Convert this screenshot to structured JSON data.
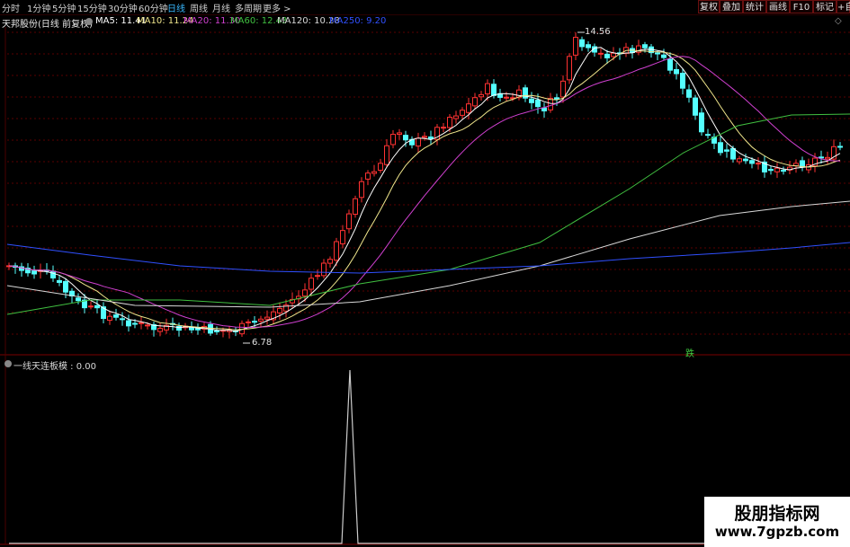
{
  "toolbar": {
    "periods": [
      "分时",
      "1分钟",
      "5分钟",
      "15分钟",
      "30分钟",
      "60分钟",
      "日线",
      "周线",
      "月线",
      "多周期",
      "更多 >"
    ],
    "active_period": "日线",
    "buttons": [
      "复权",
      "叠加",
      "统计",
      "画线",
      "F10",
      "标记",
      "+自"
    ]
  },
  "header": {
    "title": "天邦股份(日线 前复权)",
    "ma": [
      {
        "label": "MA5: 11.41",
        "color": "#ffffff"
      },
      {
        "label": "MA10: 11.24",
        "color": "#f0e68c"
      },
      {
        "label": "MA20: 11.30",
        "color": "#d040d0"
      },
      {
        "label": "MA60: 12.43",
        "color": "#40c040"
      },
      {
        "label": "MA120: 10.28",
        "color": "#d8d8d8"
      },
      {
        "label": "MA250: 9.20",
        "color": "#3050ff"
      }
    ]
  },
  "indicator": {
    "label": "一线天连板模 : 0.00",
    "signal_text": "跌"
  },
  "annotations": {
    "high": "14.56",
    "low": "6.78"
  },
  "colors": {
    "up": "#ff3232",
    "down": "#54ffff",
    "grid": "#5a0000",
    "ma5": "#ffffff",
    "ma10": "#f0e68c",
    "ma20": "#d040d0",
    "ma60": "#40c040",
    "ma120": "#d8d8d8",
    "ma250": "#3050ff",
    "signal": "#cccccc"
  },
  "watermark": {
    "line1": "股朋指标网",
    "line2": "www.7gpzb.com"
  }
}
